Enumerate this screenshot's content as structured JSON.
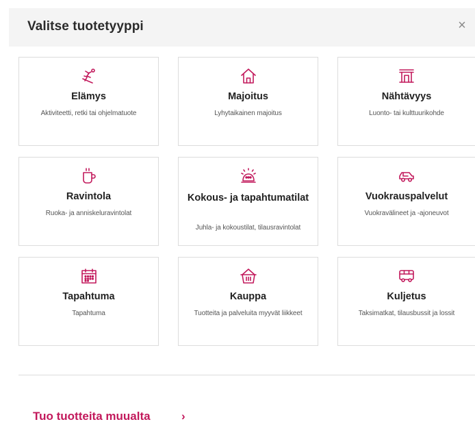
{
  "modal": {
    "title": "Valitse tuotetyyppi",
    "close_symbol": "×"
  },
  "accent_color": "#c2185b",
  "cards": [
    {
      "icon": "skier-icon",
      "name": "Elämys",
      "desc": "Aktiviteetti, retki tai ohjelmatuote"
    },
    {
      "icon": "house-icon",
      "name": "Majoitus",
      "desc": "Lyhytaikainen majoitus"
    },
    {
      "icon": "gate-icon",
      "name": "Nähtävyys",
      "desc": "Luonto- tai kulttuurikohde"
    },
    {
      "icon": "cup-icon",
      "name": "Ravintola",
      "desc": "Ruoka- ja anniskeluravintolat"
    },
    {
      "icon": "conference-phone-icon",
      "name": "Kokous- ja tapahtumatilat",
      "desc": "Juhla- ja kokoustilat, tilausravintolat"
    },
    {
      "icon": "car-icon",
      "name": "Vuokrauspalvelut",
      "desc": "Vuokravälineet ja -ajoneuvot"
    },
    {
      "icon": "calendar-icon",
      "name": "Tapahtuma",
      "desc": "Tapahtuma"
    },
    {
      "icon": "shopping-basket-icon",
      "name": "Kauppa",
      "desc": "Tuotteita ja palveluita myyvät liikkeet"
    },
    {
      "icon": "bus-icon",
      "name": "Kuljetus",
      "desc": "Taksimatkat, tilausbussit ja lossit"
    }
  ],
  "footer": {
    "import_label": "Tuo tuotteita muualta",
    "chevron": "›"
  }
}
